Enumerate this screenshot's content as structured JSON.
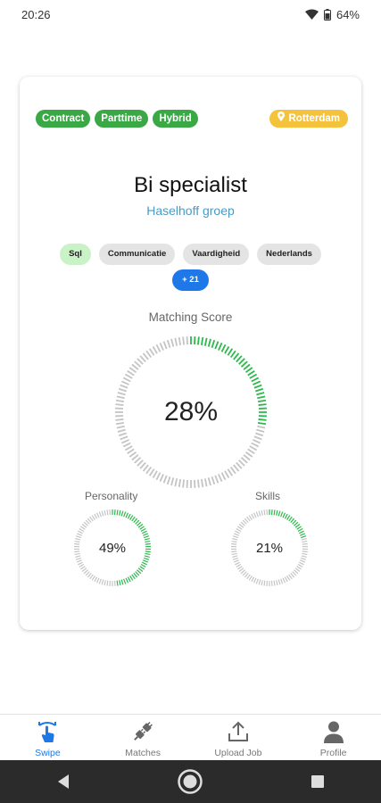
{
  "status_bar": {
    "time": "20:26",
    "battery": "64%",
    "icons": [
      "wifi-icon",
      "battery-icon"
    ]
  },
  "job": {
    "tags": [
      "Contract",
      "Parttime",
      "Hybrid"
    ],
    "location": "Rotterdam",
    "title": "Bi specialist",
    "company": "Haselhoff groep",
    "skills": [
      {
        "label": "Sql",
        "matched": true
      },
      {
        "label": "Communicatie",
        "matched": false
      },
      {
        "label": "Vaardigheid",
        "matched": false
      },
      {
        "label": "Nederlands",
        "matched": false
      }
    ],
    "more_skills": "+ 21"
  },
  "scores": {
    "matching_label": "Matching Score",
    "matching_text": "28%",
    "matching_value": 28,
    "personality_label": "Personality",
    "personality_text": "49%",
    "personality_value": 49,
    "skills_label": "Skills",
    "skills_text": "21%",
    "skills_value": 21
  },
  "nav": {
    "items": [
      {
        "label": "Swipe",
        "icon": "swipe-hand-icon",
        "active": true
      },
      {
        "label": "Matches",
        "icon": "plug-icon",
        "active": false
      },
      {
        "label": "Upload Job",
        "icon": "upload-icon",
        "active": false
      },
      {
        "label": "Profile",
        "icon": "person-icon",
        "active": false
      }
    ]
  },
  "system_nav": {
    "icons": [
      "back-icon",
      "home-icon",
      "recents-icon"
    ]
  },
  "colors": {
    "tag_green": "#3aa845",
    "location_yellow": "#f5c33b",
    "company_blue": "#4a9bc4",
    "match_chip": "#c9f2c7",
    "accent_blue": "#1e78e8",
    "ring_green": "#2db84d",
    "ring_grey": "#c4c4c4"
  }
}
